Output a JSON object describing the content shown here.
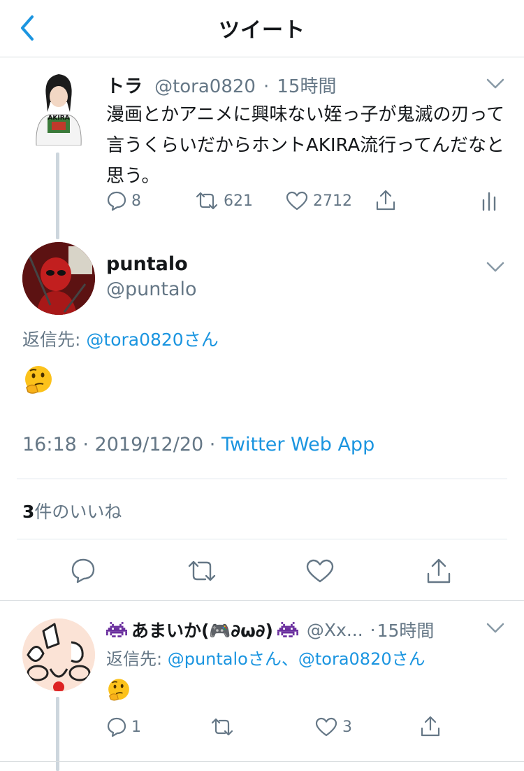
{
  "header": {
    "title": "ツイート"
  },
  "tweet1": {
    "display_name": "トラ",
    "handle": "@tora0820",
    "dot": "·",
    "time": "15時間",
    "text": "漫画とかアニメに興味ない姪っ子が鬼滅の刃って言うくらいだからホントAKIRA流行ってんだなと思う。",
    "avatar_text": "AKIRA",
    "reply_count": "8",
    "retweet_count": "621",
    "like_count": "2712"
  },
  "main": {
    "display_name": "puntalo",
    "handle": "@puntalo",
    "reply_prefix": "返信先:",
    "reply_to": "@tora0820さん",
    "timestamp": "16:18 · 2019/12/20 · ",
    "source": "Twitter Web App",
    "likes_count": "3",
    "likes_label": "件のいいね"
  },
  "reply": {
    "display_name": "あまいか(🎮∂ω∂)",
    "handle": "@Xx...",
    "dot": "·",
    "time": "15時間",
    "reply_prefix": "返信先:",
    "reply_to": "@puntaloさん、@tora0820さん",
    "reply_count": "1",
    "like_count": "3"
  },
  "colors": {
    "link": "#1b95e0",
    "secondary": "#657786",
    "text": "#14171a",
    "divider": "#e1e8ed"
  }
}
